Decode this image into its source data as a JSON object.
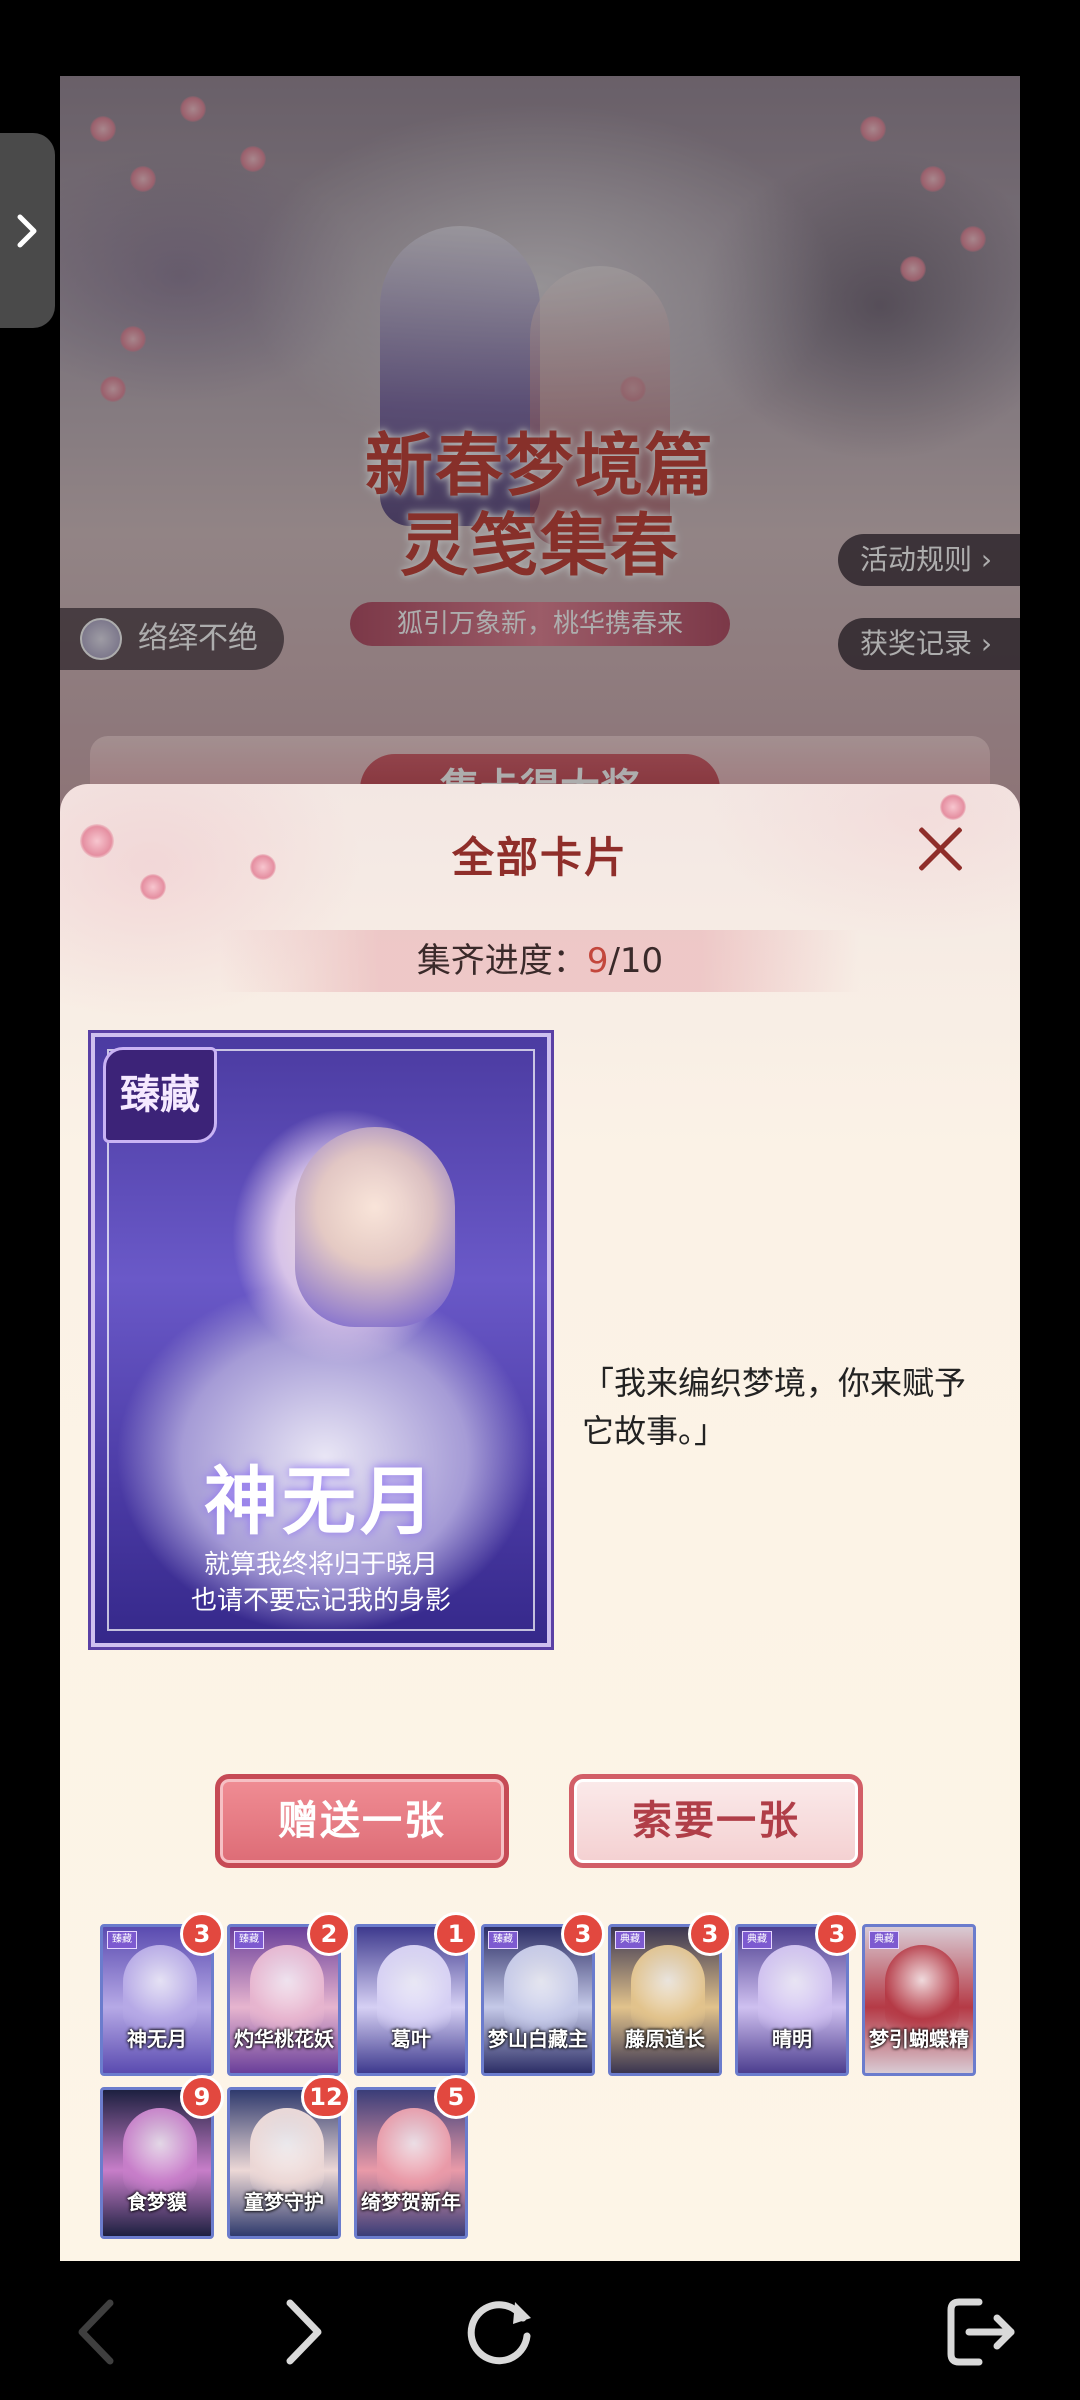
{
  "banner": {
    "title": "新春梦境篇\n灵笺集春",
    "subtitle": "狐引万象新，桃华携春来",
    "rules_label": "活动规则 ›",
    "records_label": "获奖记录 ›",
    "user_name": "络绎不绝",
    "collect_label": "集卡得大奖"
  },
  "modal": {
    "title": "全部卡片",
    "progress_label": "集齐进度：",
    "progress_current": "9",
    "progress_total": "/10",
    "featured": {
      "badge": "臻藏",
      "name": "神无月",
      "quote": "就算我终将归于晓月\n也请不要忘记我的身影",
      "description": "「我来编织梦境，你来赋予它故事。」"
    },
    "gift_label": "赠送一张",
    "request_label": "索要一张",
    "cards": [
      {
        "name": "神无月",
        "count": "3",
        "tag": "臻藏",
        "colors": [
          "#5a4bb0",
          "#b6a9e6"
        ]
      },
      {
        "name": "灼华桃花妖",
        "count": "2",
        "tag": "臻藏",
        "colors": [
          "#6a3f9a",
          "#e7b5cf"
        ]
      },
      {
        "name": "葛叶",
        "count": "1",
        "tag": "",
        "colors": [
          "#3e3a8e",
          "#d6d0f4"
        ]
      },
      {
        "name": "梦山白藏主",
        "count": "3",
        "tag": "臻藏",
        "colors": [
          "#2c2e66",
          "#c5c9e8"
        ]
      },
      {
        "name": "藤原道长",
        "count": "3",
        "tag": "典藏",
        "colors": [
          "#3a3550",
          "#e2c38c"
        ]
      },
      {
        "name": "晴明",
        "count": "3",
        "tag": "典藏",
        "colors": [
          "#4c3e8f",
          "#cfc0f0"
        ]
      },
      {
        "name": "梦引蝴蝶精",
        "count": "",
        "tag": "典藏",
        "colors": [
          "#d9cbd4",
          "#b53a46"
        ]
      },
      {
        "name": "食梦貘",
        "count": "9",
        "tag": "",
        "colors": [
          "#1d2040",
          "#c77ec9"
        ]
      },
      {
        "name": "童梦守护",
        "count": "12",
        "tag": "",
        "colors": [
          "#2f3a6d",
          "#ecd8d6"
        ]
      },
      {
        "name": "绮梦贺新年",
        "count": "5",
        "tag": "",
        "colors": [
          "#3a3d78",
          "#e99aa8"
        ]
      }
    ]
  },
  "nav": {
    "back_icon": "chevron-left-icon",
    "forward_icon": "chevron-right-icon",
    "refresh_icon": "refresh-icon",
    "exit_icon": "exit-icon"
  }
}
